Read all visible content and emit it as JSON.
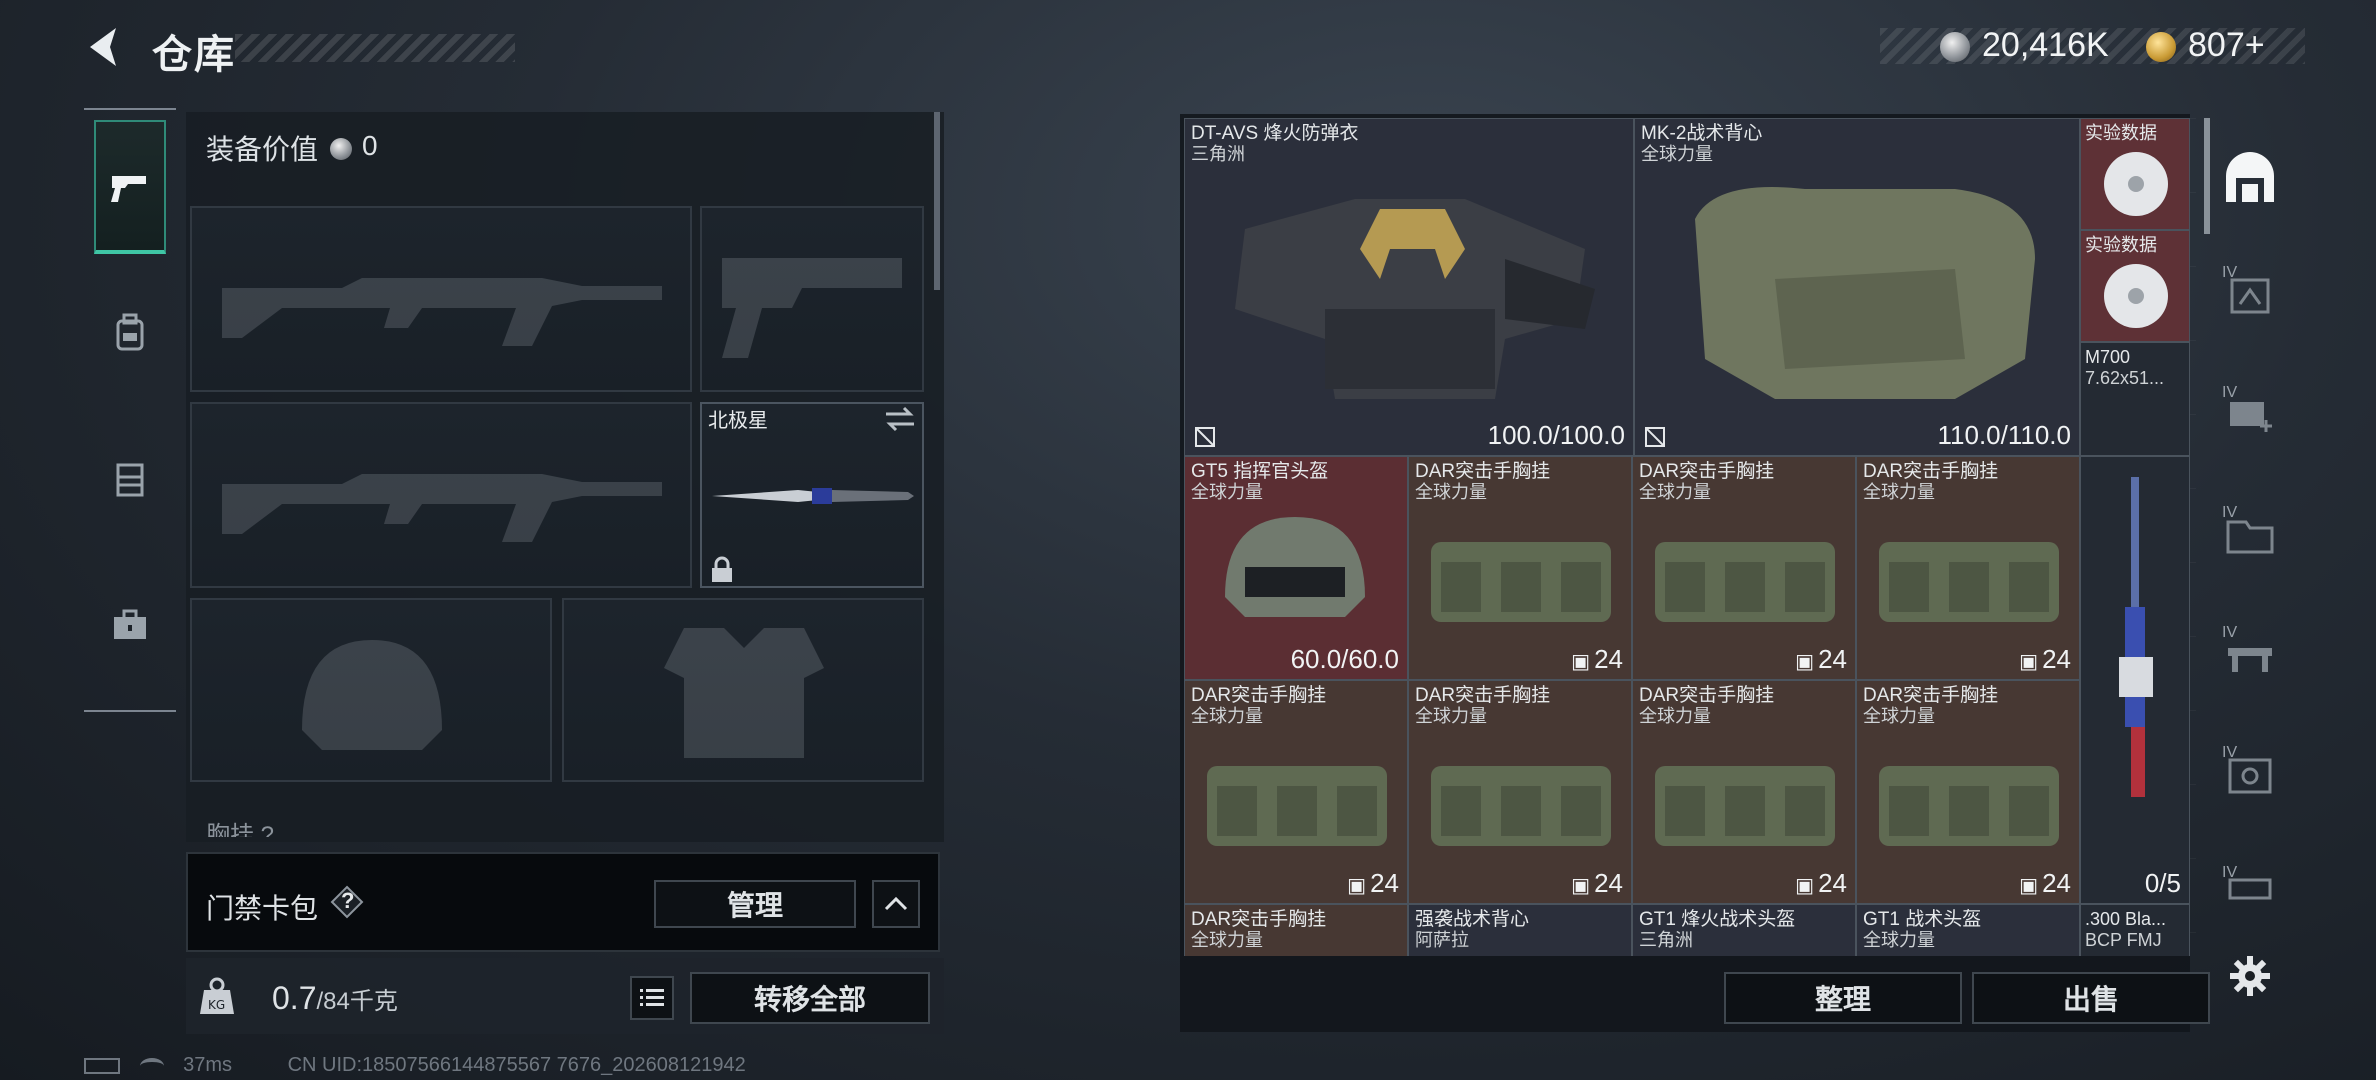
{
  "header": {
    "title": "仓库",
    "currency1": "20,416K",
    "currency2": "807+",
    "back_icon": "back-arrow-icon"
  },
  "side_tabs": [
    {
      "icon": "pistol-icon",
      "active": true
    },
    {
      "icon": "backpack-icon"
    },
    {
      "icon": "rig-icon"
    },
    {
      "icon": "briefcase-icon"
    }
  ],
  "loadout": {
    "value_label": "装备价值",
    "value": "0",
    "melee_name": "北极星",
    "chest_label": "胸挂 ?"
  },
  "card_bag": {
    "label": "门禁卡包",
    "help": "?",
    "manage_label": "管理"
  },
  "footer_left": {
    "weight": "0.7",
    "weight_max": "/84千克",
    "move_all_label": "转移全部"
  },
  "status_bar": {
    "ping": "37ms",
    "uid": "CN UID:18507566144875567 7676_202608121942"
  },
  "stash": {
    "items": [
      {
        "name": "DT-AVS 烽火防弹衣",
        "sub": "三角洲",
        "durability": "100.0/100.0",
        "kind": "armor"
      },
      {
        "name": "MK-2战术背心",
        "sub": "全球力量",
        "durability": "110.0/110.0",
        "kind": "vest"
      },
      {
        "name": "实验数据",
        "sub": "",
        "kind": "disc"
      },
      {
        "name": "实验数据",
        "sub": "",
        "kind": "disc"
      },
      {
        "name": "M700",
        "sub": "7.62x51...",
        "kind": "rifle"
      },
      {
        "name": "GT5 指挥官头盔",
        "sub": "全球力量",
        "durability": "60.0/60.0",
        "kind": "helmet"
      },
      {
        "name": "DAR突击手胸挂",
        "sub": "全球力量",
        "count": "24",
        "kind": "rig"
      },
      {
        "name": "DAR突击手胸挂",
        "sub": "全球力量",
        "count": "24",
        "kind": "rig"
      },
      {
        "name": "DAR突击手胸挂",
        "sub": "全球力量",
        "count": "24",
        "kind": "rig"
      },
      {
        "name": "DAR突击手胸挂",
        "sub": "全球力量",
        "count": "24",
        "kind": "rig"
      },
      {
        "name": "DAR突击手胸挂",
        "sub": "全球力量",
        "count": "24",
        "kind": "rig"
      },
      {
        "name": "DAR突击手胸挂",
        "sub": "全球力量",
        "count": "24",
        "kind": "rig"
      },
      {
        "name": "DAR突击手胸挂",
        "sub": "全球力量",
        "count": "24",
        "kind": "rig"
      },
      {
        "name": "DAR突击手胸挂",
        "sub": "全球力量",
        "kind": "rig"
      },
      {
        "name": "强袭战术背心",
        "sub": "阿萨拉",
        "kind": "vest"
      },
      {
        "name": "GT1 烽火战术头盔",
        "sub": "三角洲",
        "kind": "helmet"
      },
      {
        "name": "GT1 战术头盔",
        "sub": "全球力量",
        "kind": "helmet"
      },
      {
        "name": ".300 Bla...",
        "sub": "BCP FMJ",
        "kind": "ammo"
      }
    ],
    "rifle_count": "0/5",
    "sort_label": "整理",
    "sell_label": "出售"
  },
  "tool_column": [
    {
      "icon": "stash-home-icon"
    },
    {
      "lv": "IV",
      "icon": "upgrade-icon"
    },
    {
      "lv": "IV",
      "icon": "medical-upgrade-icon"
    },
    {
      "lv": "IV",
      "icon": "folder-upgrade-icon"
    },
    {
      "lv": "IV",
      "icon": "bench-upgrade-icon"
    },
    {
      "lv": "IV",
      "icon": "safe-upgrade-icon"
    },
    {
      "lv": "IV",
      "icon": "workshop-upgrade-icon"
    }
  ],
  "colors": {
    "accent": "#3fc6a5",
    "cell_red": "#5b2e33",
    "cell_brown": "#473833",
    "cell_dark": "#2b2f3b"
  }
}
